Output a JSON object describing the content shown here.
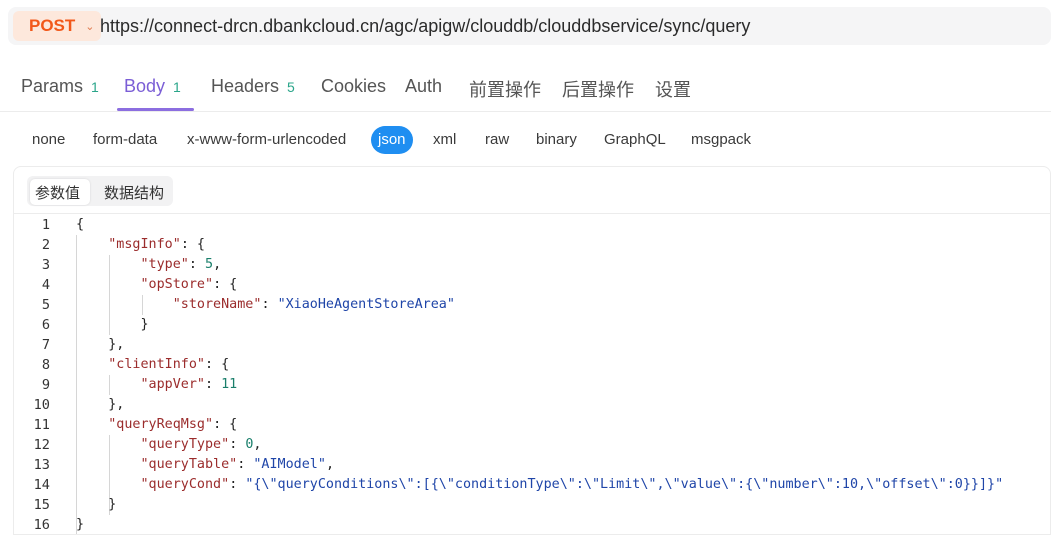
{
  "request": {
    "method": "POST",
    "url": "https://connect-drcn.dbankcloud.cn/agc/apigw/clouddb/clouddbservice/sync/query"
  },
  "tabs": [
    {
      "label": "Params",
      "count": "1"
    },
    {
      "label": "Body",
      "count": "1"
    },
    {
      "label": "Headers",
      "count": "5"
    },
    {
      "label": "Cookies",
      "count": ""
    },
    {
      "label": "Auth",
      "count": ""
    },
    {
      "label": "前置操作",
      "count": ""
    },
    {
      "label": "后置操作",
      "count": ""
    },
    {
      "label": "设置",
      "count": ""
    }
  ],
  "active_tab": "Body",
  "body_types": [
    "none",
    "form-data",
    "x-www-form-urlencoded",
    "json",
    "xml",
    "raw",
    "binary",
    "GraphQL",
    "msgpack"
  ],
  "active_body_type": "json",
  "editor_tabs": [
    "参数值",
    "数据结构"
  ],
  "active_editor_tab": "参数值",
  "code": [
    {
      "n": "1",
      "tokens": [
        [
          "pun",
          "{"
        ]
      ]
    },
    {
      "n": "2",
      "tokens": [
        [
          "key",
          "    \"msgInfo\""
        ],
        [
          "pun",
          ": {"
        ]
      ]
    },
    {
      "n": "3",
      "tokens": [
        [
          "key",
          "        \"type\""
        ],
        [
          "pun",
          ": "
        ],
        [
          "num",
          "5"
        ],
        [
          "pun",
          ","
        ]
      ]
    },
    {
      "n": "4",
      "tokens": [
        [
          "key",
          "        \"opStore\""
        ],
        [
          "pun",
          ": {"
        ]
      ]
    },
    {
      "n": "5",
      "tokens": [
        [
          "key",
          "            \"storeName\""
        ],
        [
          "pun",
          ": "
        ],
        [
          "str",
          "\"XiaoHeAgentStoreArea\""
        ]
      ]
    },
    {
      "n": "6",
      "tokens": [
        [
          "pun",
          "        }"
        ]
      ]
    },
    {
      "n": "7",
      "tokens": [
        [
          "pun",
          "    },"
        ]
      ]
    },
    {
      "n": "8",
      "tokens": [
        [
          "key",
          "    \"clientInfo\""
        ],
        [
          "pun",
          ": {"
        ]
      ]
    },
    {
      "n": "9",
      "tokens": [
        [
          "key",
          "        \"appVer\""
        ],
        [
          "pun",
          ": "
        ],
        [
          "num",
          "11"
        ]
      ]
    },
    {
      "n": "10",
      "tokens": [
        [
          "pun",
          "    },"
        ]
      ]
    },
    {
      "n": "11",
      "tokens": [
        [
          "key",
          "    \"queryReqMsg\""
        ],
        [
          "pun",
          ": {"
        ]
      ]
    },
    {
      "n": "12",
      "tokens": [
        [
          "key",
          "        \"queryType\""
        ],
        [
          "pun",
          ": "
        ],
        [
          "num",
          "0"
        ],
        [
          "pun",
          ","
        ]
      ]
    },
    {
      "n": "13",
      "tokens": [
        [
          "key",
          "        \"queryTable\""
        ],
        [
          "pun",
          ": "
        ],
        [
          "str",
          "\"AIModel\""
        ],
        [
          "pun",
          ","
        ]
      ]
    },
    {
      "n": "14",
      "tokens": [
        [
          "key",
          "        \"queryCond\""
        ],
        [
          "pun",
          ": "
        ],
        [
          "str",
          "\"{\\\"queryConditions\\\":[{\\\"conditionType\\\":\\\"Limit\\\",\\\"value\\\":{\\\"number\\\":10,\\\"offset\\\":0}}]}\""
        ]
      ]
    },
    {
      "n": "15",
      "tokens": [
        [
          "pun",
          "    }"
        ]
      ]
    },
    {
      "n": "16",
      "tokens": [
        [
          "pun",
          "}"
        ]
      ]
    }
  ]
}
